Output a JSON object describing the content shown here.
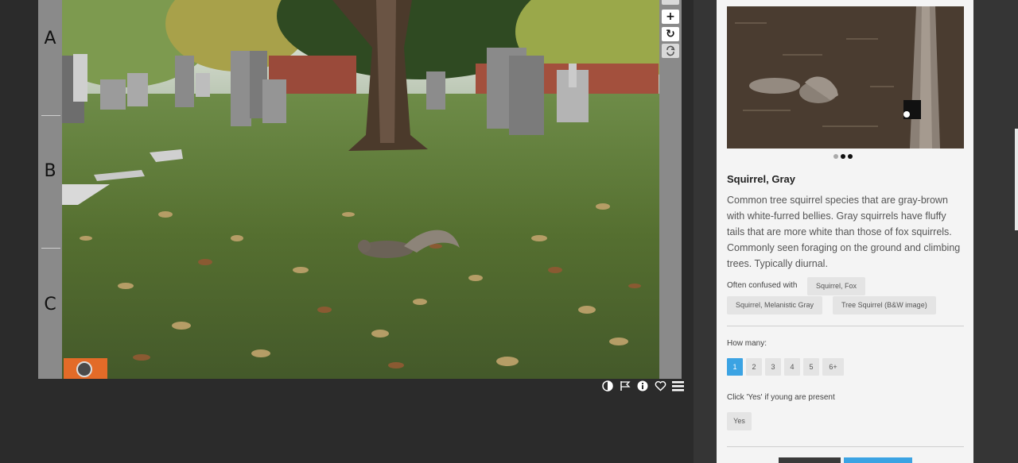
{
  "viewer": {
    "rows": [
      "A",
      "B",
      "C"
    ],
    "rail_buttons": [
      "+",
      "↻"
    ],
    "tool_icons": [
      "contrast-icon",
      "flag-icon",
      "info-icon",
      "heart-icon",
      "list-icon"
    ]
  },
  "panel": {
    "species_name": "Squirrel, Gray",
    "description": "Common tree squirrel species that are gray-brown with white-furred bellies. Gray squirrels have fluffy tails that are more white than those of fox squirrels. Commonly seen foraging on the ground and climbing trees. Typically diurnal.",
    "confused_label": "Often confused with",
    "confused_with": [
      "Squirrel, Fox",
      "Squirrel, Melanistic Gray",
      "Tree Squirrel (B&W image)"
    ],
    "how_many_label": "How many:",
    "counts": [
      "1",
      "2",
      "3",
      "4",
      "5",
      "6+"
    ],
    "selected_count": "1",
    "young_label": "Click 'Yes' if young are present",
    "young_yes": "Yes",
    "carousel_total": 3,
    "carousel_active": [
      1,
      2
    ]
  },
  "colors": {
    "accent_blue": "#3ba3e3",
    "badge_orange": "#e36b28",
    "panel_bg": "#f4f4f4",
    "page_bg": "#2b2b2b"
  }
}
